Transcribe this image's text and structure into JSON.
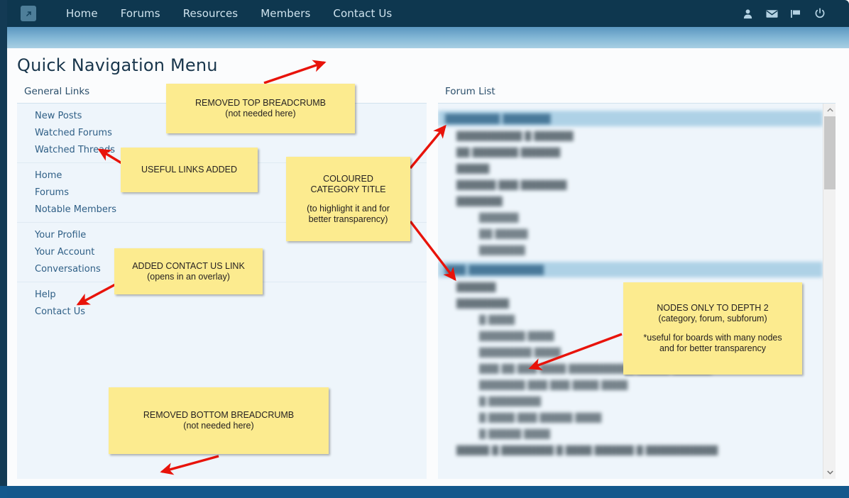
{
  "window": {
    "accent_dark": "#0e374f",
    "accent_blue": "#14588c",
    "panel_bg": "#eef5fb",
    "category_bar": "#a9cfe5",
    "note_bg": "#fceb8f",
    "arrow_color": "#e8130a"
  },
  "topnav": {
    "logo_icon": "arrow-up-right-box-icon",
    "links": [
      {
        "label": "Home"
      },
      {
        "label": "Forums"
      },
      {
        "label": "Resources"
      },
      {
        "label": "Members"
      },
      {
        "label": "Contact Us"
      }
    ],
    "icons": [
      {
        "name": "user-icon"
      },
      {
        "name": "envelope-icon"
      },
      {
        "name": "flag-icon"
      },
      {
        "name": "power-icon"
      }
    ]
  },
  "page": {
    "title": "Quick Navigation Menu"
  },
  "left_column": {
    "heading": "General Links",
    "groups": [
      {
        "items": [
          {
            "label": "New Posts"
          },
          {
            "label": "Watched Forums"
          },
          {
            "label": "Watched Threads"
          }
        ]
      },
      {
        "items": [
          {
            "label": "Home"
          },
          {
            "label": "Forums"
          },
          {
            "label": "Notable Members"
          }
        ]
      },
      {
        "items": [
          {
            "label": "Your Profile"
          },
          {
            "label": "Your Account"
          },
          {
            "label": "Conversations"
          }
        ]
      },
      {
        "items": [
          {
            "label": "Help"
          },
          {
            "label": "Contact Us"
          }
        ]
      }
    ]
  },
  "right_column": {
    "heading": "Forum List",
    "blurred": true,
    "nodes": [
      {
        "type": "category",
        "depth": 0,
        "label": "████████ ███████"
      },
      {
        "type": "forum",
        "depth": 1,
        "label": "██████████ █ ██████"
      },
      {
        "type": "forum",
        "depth": 1,
        "label": "██ ███████ ██████"
      },
      {
        "type": "forum",
        "depth": 1,
        "label": "█████"
      },
      {
        "type": "forum",
        "depth": 1,
        "label": "██████ ███ ███████"
      },
      {
        "type": "forum",
        "depth": 1,
        "label": "███████"
      },
      {
        "type": "subforum",
        "depth": 2,
        "label": "██████"
      },
      {
        "type": "subforum",
        "depth": 2,
        "label": "██ █████"
      },
      {
        "type": "subforum",
        "depth": 2,
        "label": "███████"
      },
      {
        "type": "category",
        "depth": 0,
        "label": "███ ███████████"
      },
      {
        "type": "forum",
        "depth": 1,
        "label": "██████"
      },
      {
        "type": "forum",
        "depth": 1,
        "label": "████████"
      },
      {
        "type": "subforum",
        "depth": 2,
        "label": "█ ████"
      },
      {
        "type": "subforum",
        "depth": 2,
        "label": "███████ ████"
      },
      {
        "type": "subforum",
        "depth": 2,
        "label": "████████ ████"
      },
      {
        "type": "subforum",
        "depth": 2,
        "label": "███ ██ ███ ████ ██████████ █████ ██████"
      },
      {
        "type": "subforum",
        "depth": 2,
        "label": "███████ ███ ███ ████ ████"
      },
      {
        "type": "subforum",
        "depth": 2,
        "label": "█ ████████"
      },
      {
        "type": "subforum",
        "depth": 2,
        "label": "█ ████ ███ █████ ████"
      },
      {
        "type": "subforum",
        "depth": 2,
        "label": "█ █████ ████"
      },
      {
        "type": "forum",
        "depth": 1,
        "label": "█████ █ ████████ █ ████ ██████ █ ███████████"
      }
    ],
    "scrollbar": {
      "up_arrow": "▲",
      "down_arrow": "▼"
    }
  },
  "annotations": [
    {
      "id": "removed-top-breadcrumb",
      "title": "REMOVED TOP BREADCRUMB",
      "sub": "(not needed here)",
      "sub2": "",
      "sub3": ""
    },
    {
      "id": "useful-links-added",
      "title": "USEFUL LINKS ADDED",
      "sub": "",
      "sub2": "",
      "sub3": ""
    },
    {
      "id": "coloured-category-title",
      "title": "COLOURED",
      "sub": "CATEGORY TITLE",
      "sub2": "(to highlight it and for",
      "sub3": "better transparency)"
    },
    {
      "id": "added-contact-us-link",
      "title": "ADDED CONTACT US LINK",
      "sub": "(opens in an overlay)",
      "sub2": "",
      "sub3": ""
    },
    {
      "id": "nodes-only-to-depth-2",
      "title": "NODES ONLY TO DEPTH 2",
      "sub": "(category, forum, subforum)",
      "sub2": "*useful for boards with many nodes",
      "sub3": "and for better transparency"
    },
    {
      "id": "removed-bottom-breadcrumb",
      "title": "REMOVED BOTTOM BREADCRUMB",
      "sub": "(not needed here)",
      "sub2": "",
      "sub3": ""
    }
  ]
}
